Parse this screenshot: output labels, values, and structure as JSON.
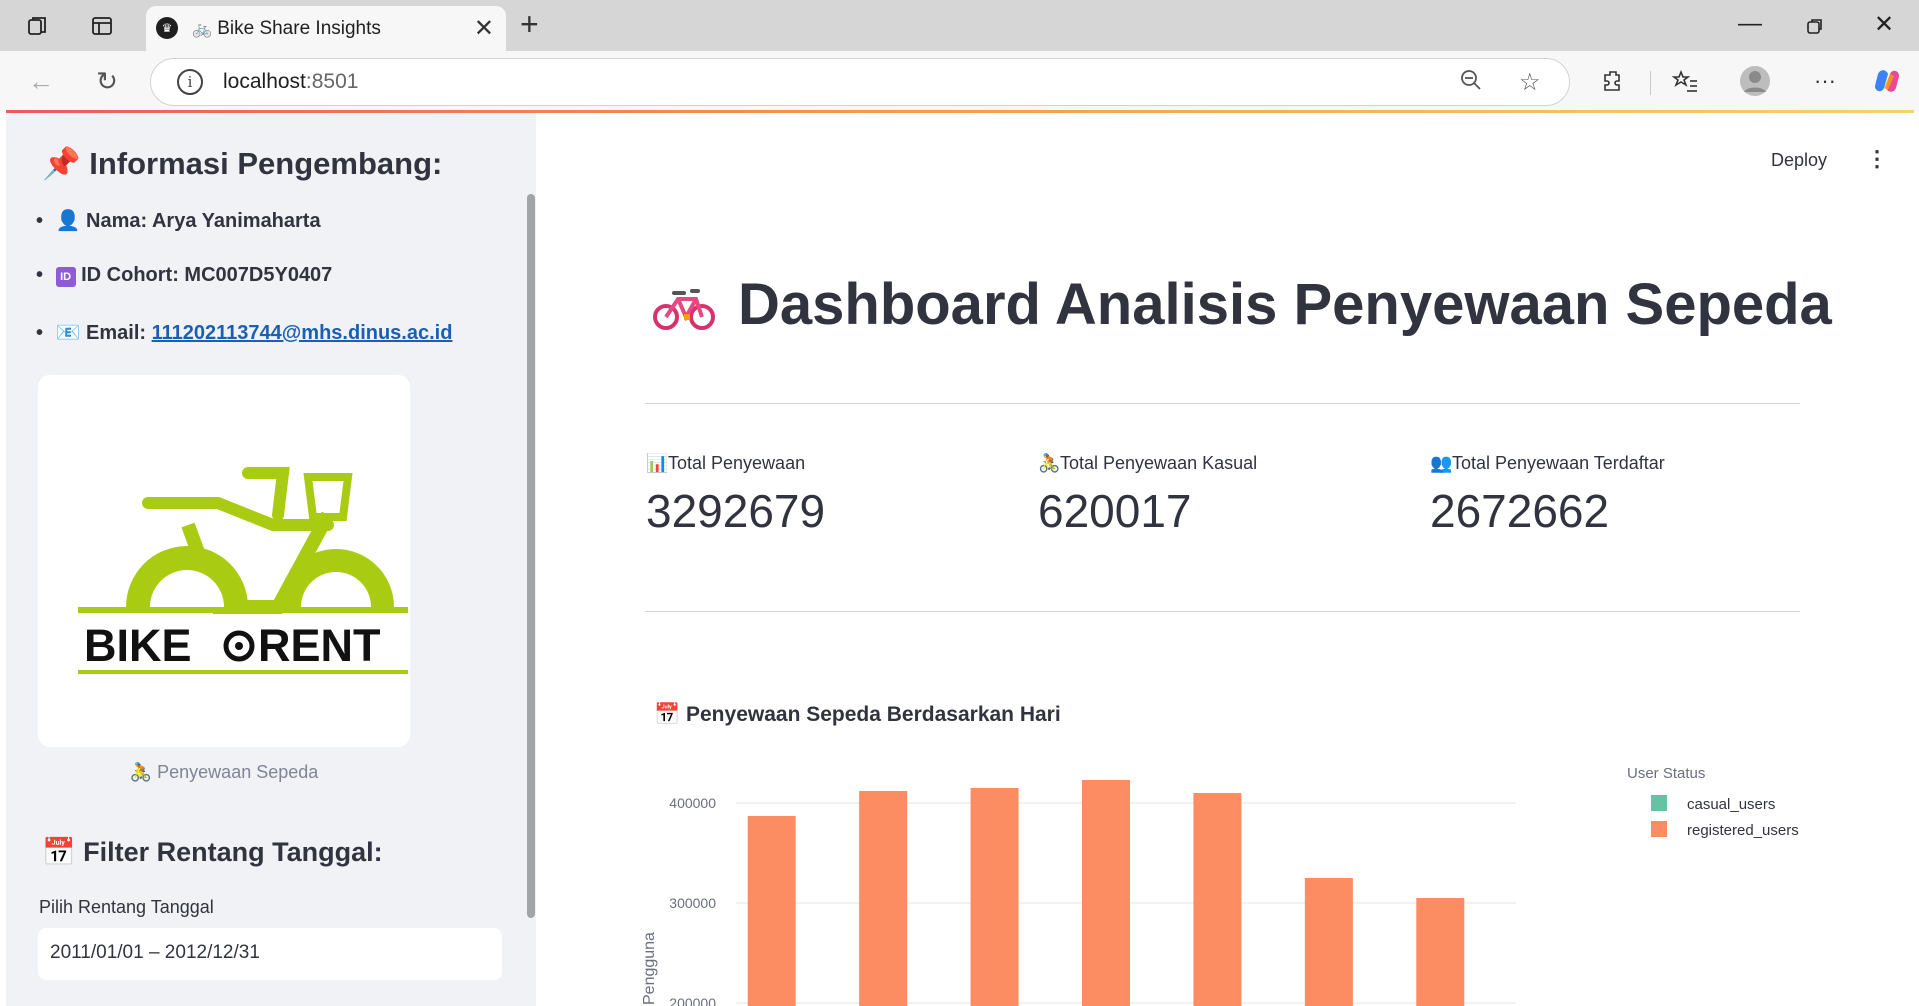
{
  "browser": {
    "tab_title": "Bike Share Insights",
    "url_host": "localhost",
    "url_port": ":8501"
  },
  "sidebar": {
    "title": "Informasi Pengembang:",
    "name_line": "Nama: Arya Yanimaharta",
    "cohort_line": "ID Cohort: MC007D5Y0407",
    "email_label": "Email:",
    "email_value": "111202113744@mhs.dinus.ac.id",
    "logo_text_left": "BIKE",
    "logo_text_right": "RENT",
    "logo_caption": "Penyewaan Sepeda",
    "filter_title": "Filter Rentang Tanggal:",
    "filter_label": "Pilih Rentang Tanggal",
    "date_range_value": "2011/01/01 – 2012/12/31"
  },
  "header": {
    "deploy_label": "Deploy"
  },
  "main": {
    "title": "Dashboard Analisis Penyewaan Sepeda",
    "metrics": [
      {
        "icon": "bar-chart-icon",
        "label": "Total Penyewaan",
        "value": "3292679"
      },
      {
        "icon": "cyclist-icon",
        "label": "Total Penyewaan Kasual",
        "value": "620017"
      },
      {
        "icon": "users-icon",
        "label": "Total Penyewaan Terdaftar",
        "value": "2672662"
      }
    ],
    "chart_title": "Penyewaan Sepeda Berdasarkan Hari"
  },
  "colors": {
    "casual": "#66c2a5",
    "registered": "#fc8d62",
    "link": "#1a5fb4",
    "logo_green": "#a9cc12"
  },
  "chart_data": {
    "type": "bar",
    "ylabel": "Jumlah Pengguna",
    "ylabel_visible_fragment": "l Pengguna",
    "yticks": [
      "400000",
      "300000",
      "200000"
    ],
    "legend_title": "User Status",
    "legend_position": "top-right",
    "visible_y_range": [
      190000,
      440000
    ],
    "series": [
      {
        "name": "casual_users",
        "values": []
      },
      {
        "name": "registered_users",
        "values": [
          387000,
          412000,
          415000,
          423000,
          410000,
          325000,
          305000
        ]
      }
    ]
  }
}
